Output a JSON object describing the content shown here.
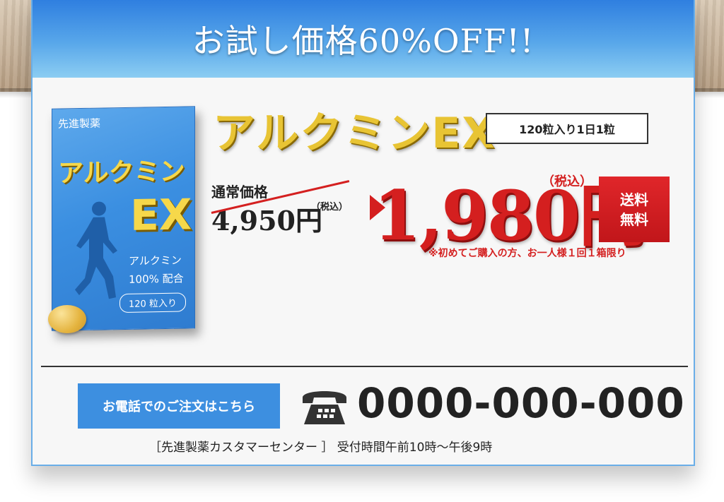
{
  "banner": {
    "text": "お試し価格60%OFF!!"
  },
  "product_box": {
    "maker": "先進製薬",
    "name": "アルクミン",
    "ex": "EX",
    "line1": "アルクミン",
    "line2": "100% 配合",
    "count": "120 粒入り"
  },
  "product": {
    "title": "アルクミンEX",
    "pack": "120粒入り1日1粒"
  },
  "pricing": {
    "regular_label": "通常価格",
    "regular_price": "4,950円",
    "regular_tax": "（税込）",
    "sale_price": "1,980円",
    "sale_tax": "（税込）",
    "shipping_line1": "送料",
    "shipping_line2": "無料",
    "note": "※初めてご購入の方、お一人様１回１箱限り"
  },
  "contact": {
    "button_label": "お電話でのご注文はこちら",
    "phone": "0000-000-000",
    "hours": "［先進製薬カスタマーセンター ］ 受付時間午前10時～午後9時"
  }
}
